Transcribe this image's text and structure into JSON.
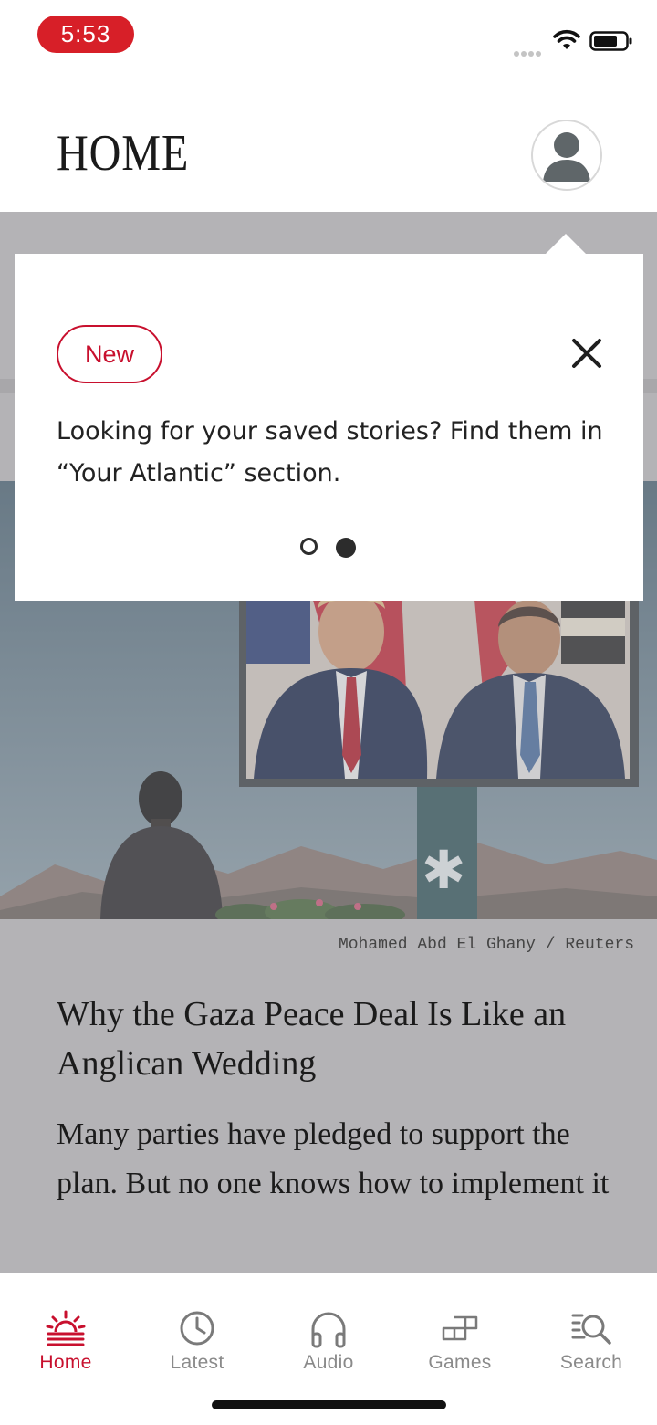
{
  "status_bar": {
    "time": "5:53"
  },
  "header": {
    "title": "HOME"
  },
  "article": {
    "photo_credit": "Mohamed Abd El Ghany / Reuters",
    "title": "Why the Gaza Peace Deal Is Like an Anglican Wedding",
    "dek": "Many parties have pledged to support the plan. But no one knows how to implement it"
  },
  "tooltip": {
    "badge": "New",
    "message": "Looking for your saved stories? Find them in “Your Atlantic” section.",
    "page_current": 2,
    "page_total": 2
  },
  "tabs": [
    {
      "label": "Home",
      "icon": "home-sunrise-icon",
      "active": true
    },
    {
      "label": "Latest",
      "icon": "clock-icon",
      "active": false
    },
    {
      "label": "Audio",
      "icon": "headphones-icon",
      "active": false
    },
    {
      "label": "Games",
      "icon": "puzzle-grid-icon",
      "active": false
    },
    {
      "label": "Search",
      "icon": "search-list-icon",
      "active": false
    }
  ],
  "colors": {
    "accent": "#c8102e",
    "time_pill": "#d71f28",
    "dim_overlay": "#b4b3b6",
    "inactive_tab": "#8a8a8a"
  }
}
